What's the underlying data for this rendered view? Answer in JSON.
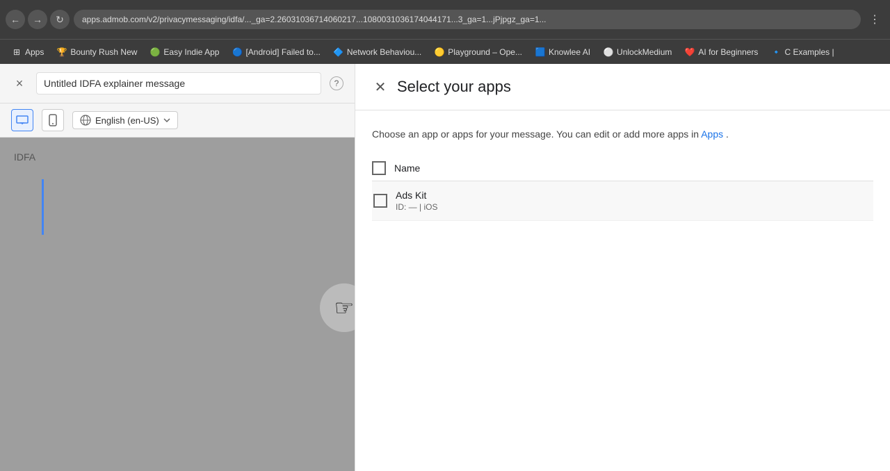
{
  "browser": {
    "address": "apps.admob.com/v2/privacymessaging/idfa/..._ga=2.26031036714060217...1080031036174044171...3_ga=1...jPjpgz_ga=1...",
    "nav_back": "←",
    "nav_forward": "→",
    "nav_refresh": "⟳",
    "extensions_icon": "⋮"
  },
  "bookmarks": [
    {
      "label": "Apps",
      "icon": "⊞"
    },
    {
      "label": "Bounty Rush New",
      "icon": "🏆"
    },
    {
      "label": "Easy Indie App",
      "icon": "🟢"
    },
    {
      "label": "[Android] Failed to...",
      "icon": "🔵"
    },
    {
      "label": "Network Behaviou...",
      "icon": "🔷"
    },
    {
      "label": "Playground – Ope...",
      "icon": "🟡"
    },
    {
      "label": "Knowlee AI",
      "icon": "🟦"
    },
    {
      "label": "UnlockMedium",
      "icon": "⚪"
    },
    {
      "label": "AI for Beginners",
      "icon": "❤️"
    },
    {
      "label": "C Examples |",
      "icon": "🔹"
    }
  ],
  "left_panel": {
    "close_label": "×",
    "title_input_value": "Untitled IDFA explainer message",
    "help_label": "?",
    "device_desktop_label": "▭",
    "device_mobile_label": "📱",
    "language_label": "English (en-US)",
    "idfa_text": "IDFA"
  },
  "modal": {
    "close_label": "×",
    "title": "Select your apps",
    "description_text": "Choose an app or apps for your message. You can edit or add more apps in",
    "description_link": "Apps",
    "description_end": ".",
    "table_header_name": "Name",
    "apps": [
      {
        "name": "Ads Kit",
        "id_label": "ID: — | iOS"
      }
    ]
  }
}
